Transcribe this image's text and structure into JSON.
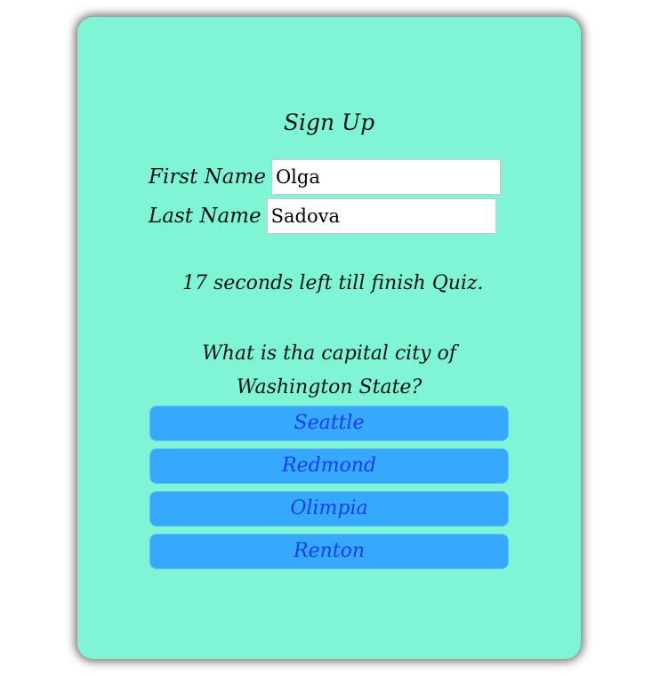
{
  "form": {
    "title": "Sign Up",
    "first_name_label": "First Name",
    "first_name_value": "Olga",
    "last_name_label": "Last Name",
    "last_name_value": "Sadova"
  },
  "quiz": {
    "timer_text": "17 seconds left till finish Quiz.",
    "question": "What is tha capital city of Washington State?",
    "answers": [
      {
        "label": "Seattle"
      },
      {
        "label": "Redmond"
      },
      {
        "label": "Olimpia"
      },
      {
        "label": "Renton"
      }
    ]
  },
  "colors": {
    "card_background": "#7ff5d6",
    "button_background": "#36a9ff",
    "button_text": "#1a3ef0"
  }
}
